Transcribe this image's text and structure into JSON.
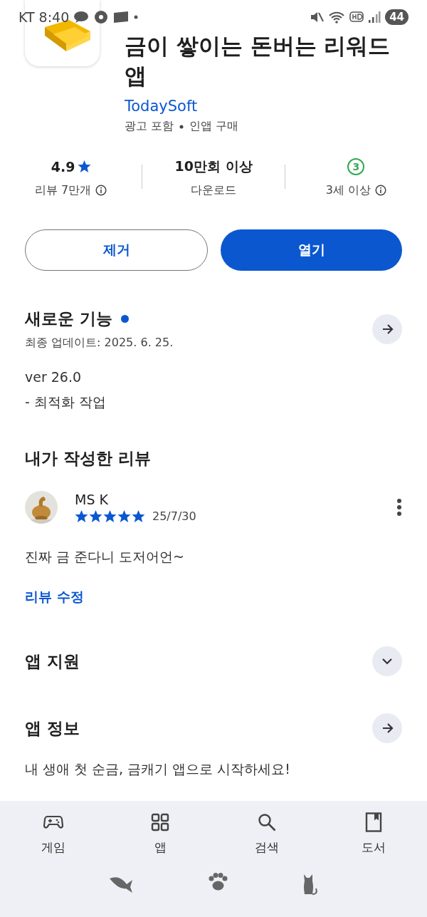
{
  "status_bar": {
    "carrier": "KT",
    "time": "8:40",
    "battery": "44"
  },
  "app": {
    "title": "금이 쌓이는 돈버는 리워드 앱",
    "developer": "TodaySoft",
    "tags": [
      "광고 포함",
      "인앱 구매"
    ]
  },
  "stats": [
    {
      "kind": "rating",
      "value": "4.9",
      "label": "리뷰 7만개",
      "info": true
    },
    {
      "kind": "text",
      "value": "10만회 이상",
      "label": "다운로드",
      "info": false
    },
    {
      "kind": "badge",
      "value": "3",
      "label": "3세 이상",
      "info": true
    }
  ],
  "buttons": [
    {
      "label": "제거",
      "kind": "outline"
    },
    {
      "label": "열기",
      "kind": "filled"
    }
  ],
  "whats_new": {
    "title": "새로운 기능",
    "new_dot": true,
    "updated": "최종 업데이트: 2025. 6. 25.",
    "notes": [
      "ver 26.0",
      "- 최적화 작업"
    ]
  },
  "my_review": {
    "title": "내가 작성한 리뷰",
    "author": "MS K",
    "stars": 5,
    "date": "25/7/30",
    "text": "진짜 금 준다니 도저어언~",
    "edit_link": "리뷰 수정"
  },
  "sections": [
    {
      "title": "앱 지원",
      "kind": "expand"
    },
    {
      "title": "앱 정보",
      "kind": "arrow",
      "description": "내 생애 첫 순금, 금캐기 앱으로 시작하세요!"
    }
  ],
  "nav": [
    {
      "label": "게임"
    },
    {
      "label": "앱"
    },
    {
      "label": "검색"
    },
    {
      "label": "도서"
    }
  ]
}
